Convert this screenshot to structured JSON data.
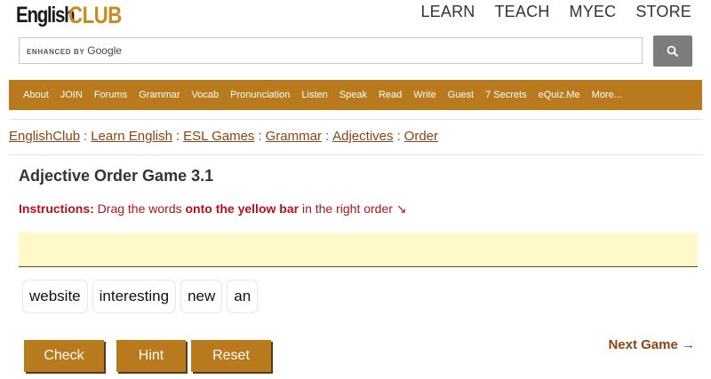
{
  "logo": {
    "part1": "English",
    "part2": "CLUB"
  },
  "top_nav": [
    "LEARN",
    "TEACH",
    "MYEC",
    "STORE"
  ],
  "search": {
    "brand": "ENHANCED BY",
    "brand_google": "Google",
    "placeholder": ""
  },
  "main_nav": [
    "About",
    "JOIN",
    "Forums",
    "Grammar",
    "Vocab",
    "Pronunciation",
    "Listen",
    "Speak",
    "Read",
    "Write",
    "Guest",
    "7 Secrets",
    "eQuiz.Me",
    "More..."
  ],
  "breadcrumb": [
    "EnglishClub",
    "Learn English",
    "ESL Games",
    "Grammar",
    "Adjectives",
    "Order"
  ],
  "breadcrumb_sep": ":",
  "game": {
    "title": "Adjective Order Game 3.1",
    "instructions_label": "Instructions:",
    "instructions_text1": " Drag the words ",
    "instructions_bold": "onto the yellow bar",
    "instructions_text2": " in the right order ↘",
    "words": [
      "website",
      "interesting",
      "new",
      "an"
    ],
    "check_label": "Check",
    "hint_label": "Hint",
    "reset_label": "Reset",
    "next_label": "Next Game →"
  },
  "colors": {
    "brand": "#b97a1d",
    "link": "#8b4513",
    "instruction": "#b5121b",
    "dropbar": "#fff9c9"
  }
}
